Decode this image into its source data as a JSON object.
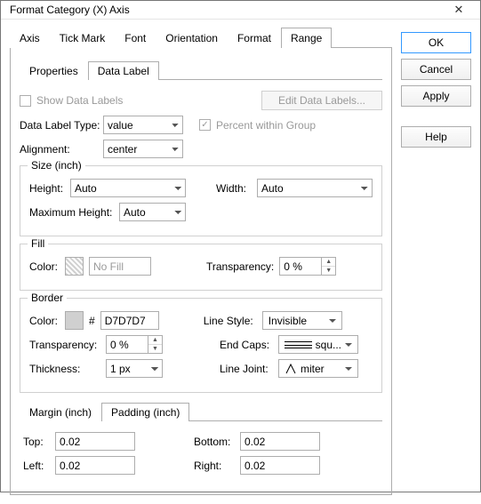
{
  "window": {
    "title": "Format Category (X) Axis"
  },
  "main_tabs": [
    "Axis",
    "Tick Mark",
    "Font",
    "Orientation",
    "Format",
    "Range"
  ],
  "buttons": {
    "ok": "OK",
    "cancel": "Cancel",
    "apply": "Apply",
    "help": "Help"
  },
  "sub_tabs": [
    "Properties",
    "Data Label"
  ],
  "datalabel": {
    "show_data_labels": "Show Data Labels",
    "edit_btn": "Edit Data Labels...",
    "type_label": "Data Label Type:",
    "type_value": "value",
    "percent_label": "Percent within Group",
    "alignment_label": "Alignment:",
    "alignment_value": "center"
  },
  "size": {
    "legend": "Size (inch)",
    "height_label": "Height:",
    "height_value": "Auto",
    "width_label": "Width:",
    "width_value": "Auto",
    "maxh_label": "Maximum Height:",
    "maxh_value": "Auto"
  },
  "fill": {
    "legend": "Fill",
    "color_label": "Color:",
    "color_text": "No Fill",
    "transparency_label": "Transparency:",
    "transparency_value": "0 %"
  },
  "border": {
    "legend": "Border",
    "color_label": "Color:",
    "color_hex": "D7D7D7",
    "linestyle_label": "Line Style:",
    "linestyle_value": "Invisible",
    "transparency_label": "Transparency:",
    "transparency_value": "0 %",
    "endcaps_label": "End Caps:",
    "endcaps_value": "squ...",
    "thickness_label": "Thickness:",
    "thickness_value": "1 px",
    "linejoint_label": "Line Joint:",
    "linejoint_value": "miter"
  },
  "mp_tabs": [
    "Margin (inch)",
    "Padding (inch)"
  ],
  "padding": {
    "top_label": "Top:",
    "top_value": "0.02",
    "bottom_label": "Bottom:",
    "bottom_value": "0.02",
    "left_label": "Left:",
    "left_value": "0.02",
    "right_label": "Right:",
    "right_value": "0.02"
  }
}
